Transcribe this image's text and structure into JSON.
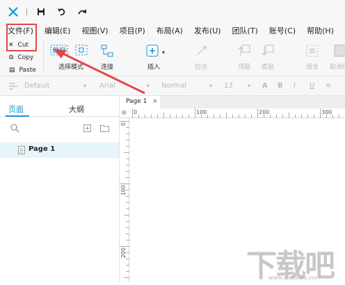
{
  "quickbar": {
    "logo_icon": "axure-x-logo",
    "buttons": [
      "save-icon",
      "undo-icon",
      "redo-icon"
    ]
  },
  "menubar": {
    "items": [
      "文件(F)",
      "编辑(E)",
      "视图(V)",
      "项目(P)",
      "布局(A)",
      "发布(U)",
      "团队(T)",
      "账号(C)",
      "帮助(H)"
    ]
  },
  "ribbon": {
    "clipboard": {
      "cut": "Cut",
      "copy": "Copy",
      "paste": "Paste"
    },
    "select_mode": "选择模式",
    "connect": "连接",
    "insert": "插入",
    "point": "控点",
    "top": "顶层",
    "bottom": "底层",
    "group": "组合",
    "ungroup": "取消组"
  },
  "formatbar": {
    "style": "Default",
    "font": "Arial",
    "weight": "Normal",
    "size": "13",
    "buttons": [
      "A",
      "B",
      "I",
      "U",
      "≡"
    ]
  },
  "leftpanel": {
    "tabs": [
      "页面",
      "大纲"
    ],
    "active_tab": "页面",
    "pages": [
      "Page 1"
    ]
  },
  "canvas": {
    "tab_label": "Page 1",
    "ruler_h": [
      "0",
      "100",
      "200",
      "300"
    ],
    "ruler_v": [
      "0",
      "100",
      "200"
    ]
  },
  "watermark": {
    "text": "下载吧",
    "url": "www.xiazaiba.com"
  },
  "colors": {
    "accent": "#1c8fd6",
    "highlight": "#e0494b",
    "selected_row": "#e6f4fb"
  }
}
